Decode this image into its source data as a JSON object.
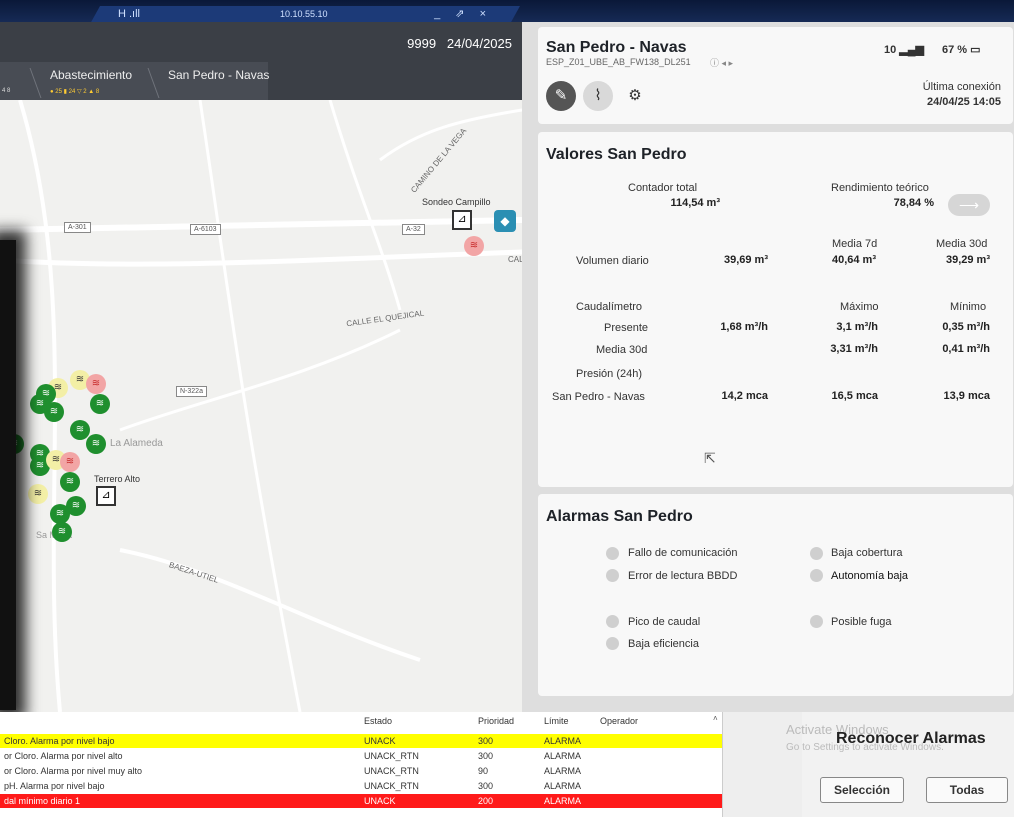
{
  "window": {
    "ip": "10.10.55.10",
    "signal": "H .ıll",
    "controls": "_ ⇗ ×"
  },
  "header": {
    "code": "9999",
    "date": "24/04/2025"
  },
  "breadcrumb": {
    "item1": "Abastecimiento",
    "item2": "San Pedro - Navas",
    "counts": "● 25 ▮ 24 ▽ 2 ▲ 8",
    "leftcounts": "4 8"
  },
  "map": {
    "labels": [
      "A-301",
      "A-6103",
      "A-32",
      "N-322a"
    ],
    "texts": [
      "CAMINO DE LA VEGA",
      "Sondeo Campillo",
      "CALLE EL QUEJICAL",
      "Terrero Alto",
      "BAEZA-UTIEL",
      "La Alameda",
      "CAL",
      "Sa Maria"
    ],
    "layer_icon": "layers-icon"
  },
  "device": {
    "title": "San Pedro - Navas",
    "id": "ESP_Z01_UBE_AB_FW138_DL251",
    "signal": "10",
    "battery": "67 %",
    "last_conn_label": "Última conexión",
    "last_conn_value": "24/04/25 14:05",
    "icons": [
      "edit-icon",
      "chart-icon",
      "gear-icon"
    ]
  },
  "values": {
    "title": "Valores San Pedro",
    "contador_label": "Contador total",
    "contador_value": "114,54 m³",
    "rend_label": "Rendimiento teórico",
    "rend_value": "78,84 %",
    "media7_label": "Media 7d",
    "media30_label": "Media 30d",
    "vol_label": "Volumen diario",
    "vol_value": "39,69 m³",
    "vol_media7": "40,64 m³",
    "vol_media30": "39,29 m³",
    "caudal_label": "Caudalímetro",
    "max_label": "Máximo",
    "min_label": "Mínimo",
    "presente_label": "Presente",
    "presente_value": "1,68 m³/h",
    "presente_max": "3,1 m³/h",
    "presente_min": "0,35 m³/h",
    "media30d_label": "Media 30d",
    "media30d_max": "3,31 m³/h",
    "media30d_min": "0,41 m³/h",
    "presion_label": "Presión (24h)",
    "sp_label": "San Pedro - Navas",
    "sp_value": "14,2 mca",
    "sp_max": "16,5 mca",
    "sp_min": "13,9 mca"
  },
  "alarms": {
    "title": "Alarmas San Pedro",
    "items": [
      "Fallo de comunicación",
      "Error de lectura BBDD",
      "Pico de caudal",
      "Baja eficiencia",
      "Baja cobertura",
      "Autonomía baja",
      "Posible fuga"
    ]
  },
  "table": {
    "headers": {
      "estado": "Estado",
      "prioridad": "Prioridad",
      "limite": "Límite",
      "operador": "Operador"
    },
    "rows": [
      {
        "desc": "Cloro. Alarma por nivel bajo",
        "estado": "UNACK",
        "prioridad": "300",
        "limite": "ALARMA",
        "bg": "#ffff00"
      },
      {
        "desc": "or Cloro. Alarma por nivel alto",
        "estado": "UNACK_RTN",
        "prioridad": "300",
        "limite": "ALARMA",
        "bg": "#ffffff"
      },
      {
        "desc": "or Cloro. Alarma por nivel muy alto",
        "estado": "UNACK_RTN",
        "prioridad": "90",
        "limite": "ALARMA",
        "bg": "#ffffff"
      },
      {
        "desc": "pH. Alarma por nivel bajo",
        "estado": "UNACK_RTN",
        "prioridad": "300",
        "limite": "ALARMA",
        "bg": "#ffffff"
      },
      {
        "desc": "dal mínimo diario 1",
        "estado": "UNACK",
        "prioridad": "200",
        "limite": "ALARMA",
        "bg": "#ff1a1a"
      }
    ]
  },
  "ack": {
    "title": "Reconocer Alarmas",
    "sel": "Selección",
    "all": "Todas",
    "watermark1": "Activate Windows",
    "watermark2": "Go to Settings to activate Windows."
  }
}
